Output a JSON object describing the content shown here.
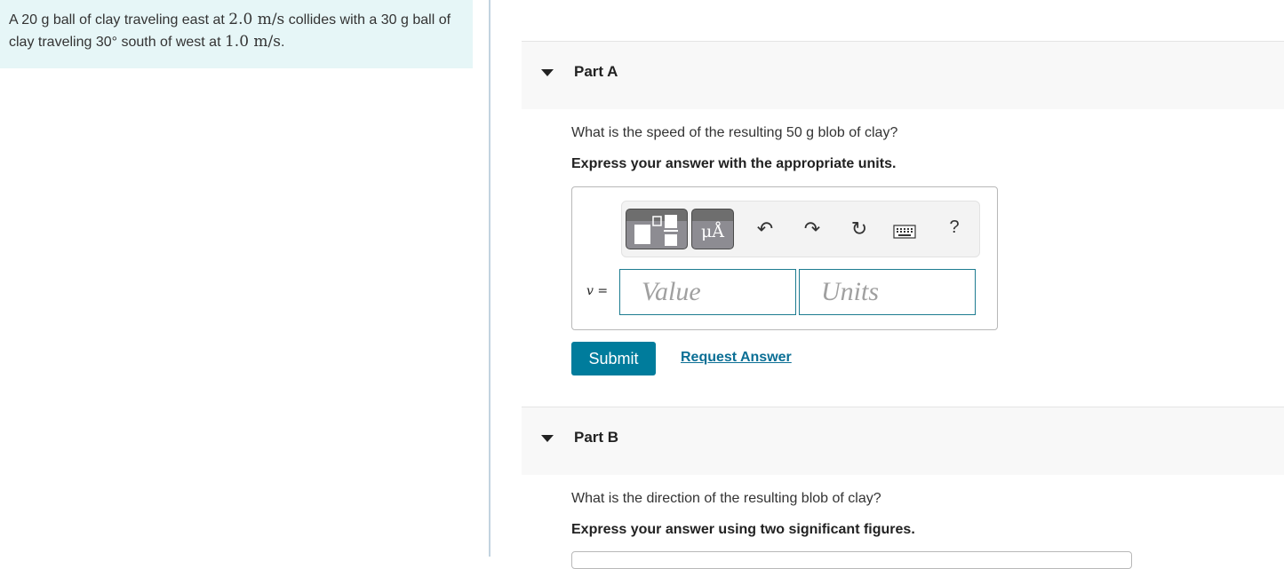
{
  "problem": {
    "text_1": "A 20 g ball of clay traveling east at ",
    "math_1": "2.0 m/s",
    "text_2": " collides with a 30 g ball of clay traveling 30° south of west at ",
    "math_2": "1.0 m/s",
    "text_3": "."
  },
  "part_a": {
    "title": "Part A",
    "question": "What is the speed of the resulting 50 g blob of clay?",
    "instruction": "Express your answer with the appropriate units.",
    "toolbar": {
      "templates_icon": "templates-icon",
      "units_label": "μÅ",
      "undo_icon": "undo-icon",
      "redo_icon": "redo-icon",
      "reset_icon": "reset-icon",
      "keyboard_icon": "keyboard-icon",
      "help_label": "?"
    },
    "variable_label": "v =",
    "value_placeholder": "Value",
    "units_placeholder": "Units",
    "submit_label": "Submit",
    "request_answer_label": "Request Answer"
  },
  "part_b": {
    "title": "Part B",
    "question": "What is the direction of the resulting blob of clay?",
    "instruction": "Express your answer using two significant figures."
  }
}
